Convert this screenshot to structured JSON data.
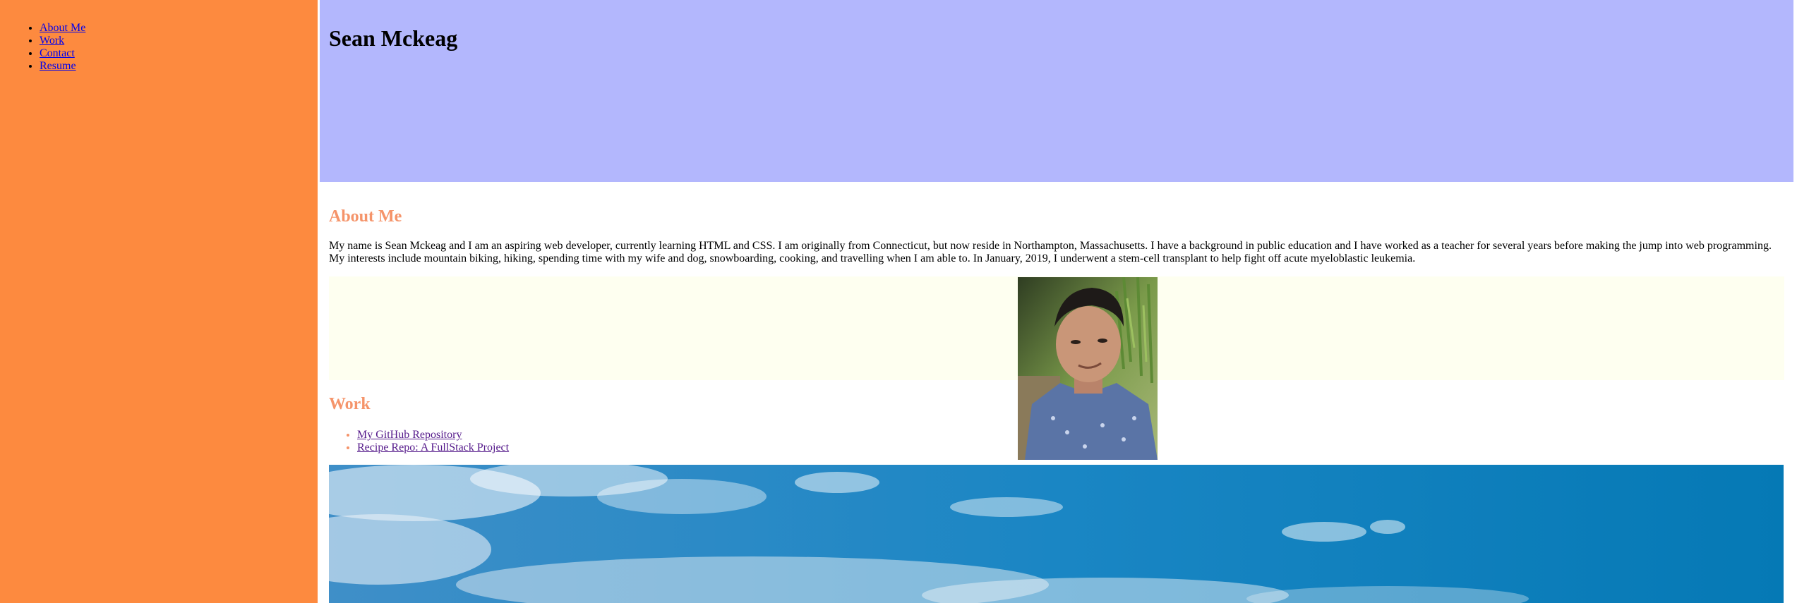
{
  "nav": {
    "items": [
      {
        "label": "About Me"
      },
      {
        "label": "Work"
      },
      {
        "label": "Contact"
      },
      {
        "label": "Resume"
      }
    ]
  },
  "header": {
    "title": "Sean Mckeag"
  },
  "about": {
    "heading": "About Me",
    "text": "My name is Sean Mckeag and I am an aspiring web developer, currently learning HTML and CSS. I am originally from Connecticut, but now reside in Northampton, Massachusetts. I have a background in public education and I have worked as a teacher for several years before making the jump into web programming. My interests include mountain biking, hiking, spending time with my wife and dog, snowboarding, cooking, and travelling when I am able to. In January, 2019, I underwent a stem-cell transplant to help fight off acute myeloblastic leukemia."
  },
  "work": {
    "heading": "Work",
    "links": [
      {
        "label": "My GitHub Repository"
      },
      {
        "label": "Recipe Repo: A FullStack Project"
      }
    ]
  },
  "colors": {
    "sidebar": "#fd8a3f",
    "header": "#b3b7fd",
    "heading": "#f5946a",
    "photo_band": "#fefff0"
  }
}
